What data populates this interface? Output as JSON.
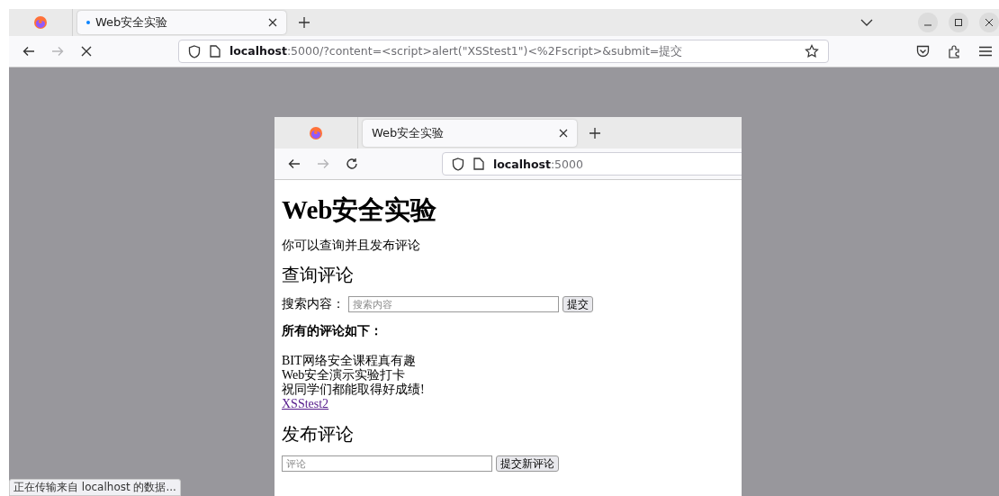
{
  "outer_browser": {
    "tab": {
      "title": "Web安全实验",
      "loading": true,
      "selected": true
    },
    "nav": [
      {
        "kind": "back",
        "disabled": false
      },
      {
        "kind": "forward",
        "disabled": true
      },
      {
        "kind": "stop",
        "disabled": false
      }
    ],
    "url": "**localhost**:5000/?content=<script>alert(\"XSStest1\")<%2Fscript>&submit=提交"
  },
  "inner_browser": {
    "tab": {
      "title": "Web安全实验",
      "loading": false,
      "selected": true
    },
    "nav": [
      {
        "kind": "back",
        "disabled": false
      },
      {
        "kind": "forward",
        "disabled": true
      },
      {
        "kind": "reload",
        "disabled": false
      }
    ],
    "url": "**localhost**:5000"
  },
  "page": {
    "title": "Web安全实验",
    "intro": "你可以查询并且发布评论",
    "search_heading": "查询评论",
    "search_label": "搜索内容：",
    "search": {
      "placeholder": "搜索内容"
    },
    "search_button": "提交",
    "comments_heading": "所有的评论如下：",
    "comments": [
      {
        "kind": "text",
        "text": "BIT网络安全课程真有趣"
      },
      {
        "kind": "text",
        "text": "Web安全演示实验打卡"
      },
      {
        "kind": "text",
        "text": "祝同学们都能取得好成绩!"
      },
      {
        "kind": "link",
        "text": "XSStest2"
      }
    ],
    "post_heading": "发布评论",
    "comment": {
      "placeholder": "评论"
    },
    "post_button": "提交新评论"
  },
  "status_bar": "正在传输来自 localhost 的数据..."
}
